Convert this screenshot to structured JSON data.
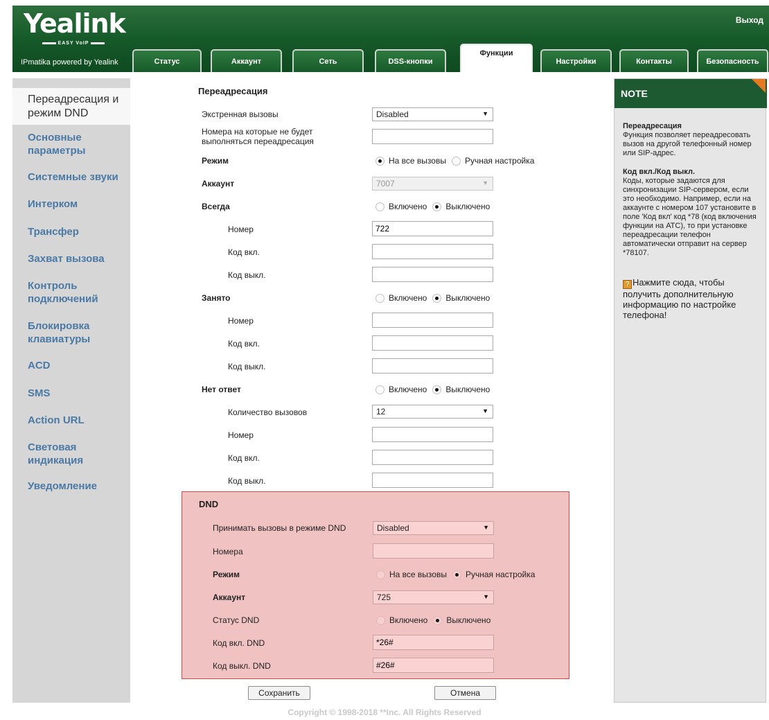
{
  "header": {
    "logo": "Yealink",
    "logo_tagline": "EASY VoIP",
    "logo_subtitle": "IPmatika powered by Yealink",
    "logout": "Выход",
    "tabs": [
      {
        "label": "Статус"
      },
      {
        "label": "Аккаунт"
      },
      {
        "label": "Сеть"
      },
      {
        "label": "DSS-кнопки"
      },
      {
        "label": "Функции",
        "active": true
      },
      {
        "label": "Настройки"
      },
      {
        "label": "Контакты"
      },
      {
        "label": "Безопасность"
      }
    ]
  },
  "sidebar": {
    "items": [
      {
        "label": "Переадресация и режим DND",
        "active": true
      },
      {
        "label": "Основные параметры"
      },
      {
        "label": "Системные звуки"
      },
      {
        "label": "Интерком"
      },
      {
        "label": "Трансфер"
      },
      {
        "label": "Захват вызова"
      },
      {
        "label": "Контроль подключений"
      },
      {
        "label": "Блокировка клавиатуры"
      },
      {
        "label": "ACD"
      },
      {
        "label": "SMS"
      },
      {
        "label": "Action URL"
      },
      {
        "label": "Световая индикация"
      },
      {
        "label": "Уведомление"
      }
    ]
  },
  "forward": {
    "title": "Переадресация",
    "emergency_label": "Экстренная вызовы",
    "emergency_value": "Disabled",
    "no_forward_label": "Номера на которые не будет выполняться переадресация",
    "no_forward_value": "",
    "mode_label": "Режим",
    "mode_all": "На все вызовы",
    "mode_manual": "Ручная настройка",
    "account_label": "Аккаунт",
    "account_value": "7007",
    "always_label": "Всегда",
    "on": "Включено",
    "off": "Выключено",
    "number_label": "Номер",
    "on_code_label": "Код вкл.",
    "off_code_label": "Код выкл.",
    "always_number": "722",
    "always_on_code": "",
    "always_off_code": "",
    "busy_label": "Занято",
    "busy_number": "",
    "busy_on_code": "",
    "busy_off_code": "",
    "noanswer_label": "Нет ответ",
    "ring_count_label": "Количество вызовов",
    "ring_count_value": "12",
    "noanswer_number": "",
    "noanswer_on_code": "",
    "noanswer_off_code": ""
  },
  "dnd": {
    "title": "DND",
    "accept_label": "Принимать вызовы в режиме DND",
    "accept_value": "Disabled",
    "numbers_label": "Номера",
    "numbers_value": "",
    "mode_label": "Режим",
    "mode_all": "На все вызовы",
    "mode_manual": "Ручная настройка",
    "account_label": "Аккаунт",
    "account_value": "725",
    "status_label": "Статус DND",
    "on": "Включено",
    "off": "Выключено",
    "on_code_label": "Код вкл. DND",
    "on_code_value": "*26#",
    "off_code_label": "Код выкл. DND",
    "off_code_value": "#26#"
  },
  "buttons": {
    "save": "Сохранить",
    "cancel": "Отмена"
  },
  "note": {
    "title": "NOTE",
    "p1_title": "Переадресация",
    "p1_text": "Функция позволяет переадресовать вызов на другой телефонный номер или SIP-адрес.",
    "p2_title": "Код вкл./Код выкл.",
    "p2_text": "Коды, которые задаются для синхронизации SIP-сервером, если это необходимо. Например, если на аккаунте с номером 107 установите в поле 'Код вкл' код *78 (код включения функции на АТС), то при установке переадресации телефон автоматически отправит на сервер *78107.",
    "help_text": "Нажмите сюда, чтобы получить дополнительную информацию по настройке телефона!"
  },
  "footer": {
    "copyright": "Copyright © 1998-2018 **Inc. All Rights Reserved"
  },
  "colors": {
    "header_green": "#175a2a",
    "nav_blue": "#4a79a5",
    "dnd_highlight": "#f1c2c2",
    "dnd_border": "#cc4b4b",
    "note_corner": "#e47a22"
  }
}
